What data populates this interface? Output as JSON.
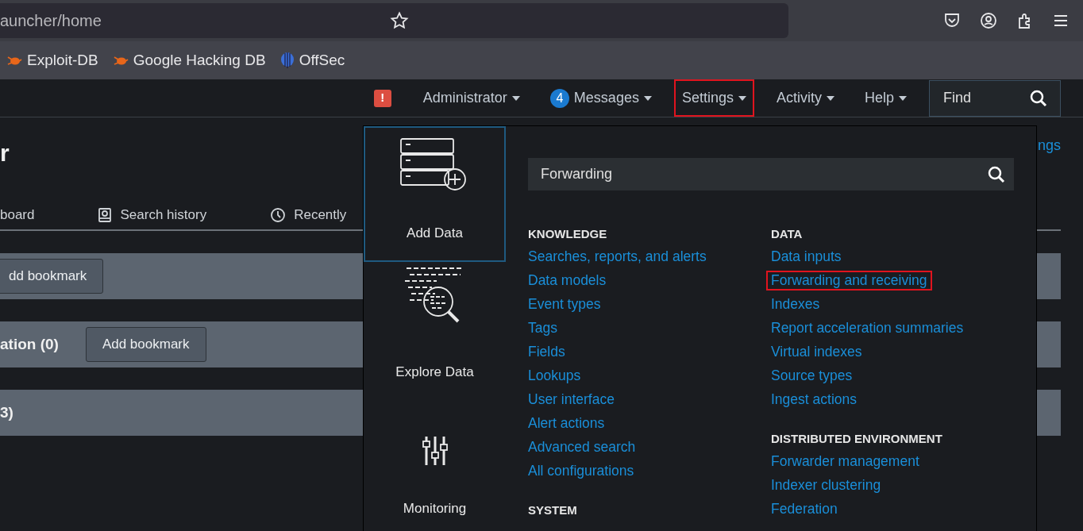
{
  "browser": {
    "url": "auncher/home",
    "bookmarks": [
      {
        "label": "Exploit-DB",
        "kind": "bug"
      },
      {
        "label": "Google Hacking DB",
        "kind": "bug"
      },
      {
        "label": "OffSec",
        "kind": "offsec"
      }
    ]
  },
  "app_bar": {
    "alert": "!",
    "menus": [
      {
        "label": "Administrator",
        "highlighted": false
      },
      {
        "label": "Messages",
        "badge": "4",
        "highlighted": false
      },
      {
        "label": "Settings",
        "highlighted": true
      },
      {
        "label": "Activity",
        "highlighted": false
      },
      {
        "label": "Help",
        "highlighted": false
      }
    ],
    "find": {
      "placeholder": "Find"
    }
  },
  "page": {
    "title": "r",
    "settings_link": "ngs",
    "tabs": [
      {
        "label": "board",
        "kind": "plain"
      },
      {
        "label": "Search history",
        "kind": "history"
      },
      {
        "label": "Recently",
        "kind": "clock"
      }
    ],
    "panels": [
      {
        "button": "dd bookmark"
      },
      {
        "label": "ation (0)",
        "button": "Add bookmark"
      },
      {
        "label": "3)"
      }
    ]
  },
  "settings_menu": {
    "tiles": [
      {
        "label": "Add Data",
        "kind": "add",
        "selected": true
      },
      {
        "label": "Explore Data",
        "kind": "explore",
        "selected": false
      },
      {
        "label": "Monitoring",
        "kind": "monitor",
        "selected": false
      }
    ],
    "search": {
      "value": "Forwarding"
    },
    "columns": [
      [
        {
          "heading": "KNOWLEDGE",
          "links": [
            {
              "label": "Searches, reports, and alerts",
              "highlighted": false
            },
            {
              "label": "Data models",
              "highlighted": false
            },
            {
              "label": "Event types",
              "highlighted": false
            },
            {
              "label": "Tags",
              "highlighted": false
            },
            {
              "label": "Fields",
              "highlighted": false
            },
            {
              "label": "Lookups",
              "highlighted": false
            },
            {
              "label": "User interface",
              "highlighted": false
            },
            {
              "label": "Alert actions",
              "highlighted": false
            },
            {
              "label": "Advanced search",
              "highlighted": false
            },
            {
              "label": "All configurations",
              "highlighted": false
            }
          ]
        },
        {
          "heading": "SYSTEM"
        }
      ],
      [
        {
          "heading": "DATA",
          "links": [
            {
              "label": "Data inputs",
              "highlighted": false
            },
            {
              "label": "Forwarding and receiving",
              "highlighted": true
            },
            {
              "label": "Indexes",
              "highlighted": false
            },
            {
              "label": "Report acceleration summaries",
              "highlighted": false
            },
            {
              "label": "Virtual indexes",
              "highlighted": false
            },
            {
              "label": "Source types",
              "highlighted": false
            },
            {
              "label": "Ingest actions",
              "highlighted": false
            }
          ]
        },
        {
          "heading": "DISTRIBUTED ENVIRONMENT",
          "links": [
            {
              "label": "Forwarder management",
              "highlighted": false
            },
            {
              "label": "Indexer clustering",
              "highlighted": false
            },
            {
              "label": "Federation",
              "highlighted": false
            }
          ]
        }
      ]
    ]
  }
}
